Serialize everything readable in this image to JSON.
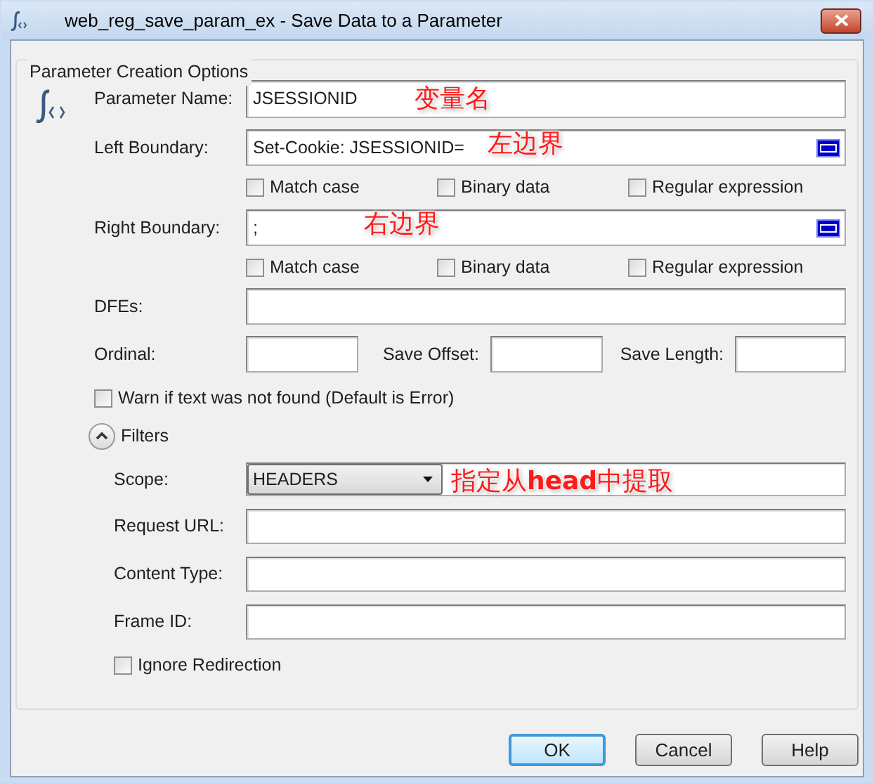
{
  "window": {
    "title": "web_reg_save_param_ex - Save Data to a Parameter"
  },
  "group": {
    "title": "Parameter Creation Options"
  },
  "parameter_name": {
    "label": "Parameter Name:",
    "value": "JSESSIONID",
    "annotation": "变量名"
  },
  "left_boundary": {
    "label": "Left Boundary:",
    "value": "Set-Cookie: JSESSIONID=",
    "annotation": "左边界",
    "options": [
      {
        "label": "Match case",
        "checked": false
      },
      {
        "label": "Binary data",
        "checked": false
      },
      {
        "label": "Regular expression",
        "checked": false
      }
    ]
  },
  "right_boundary": {
    "label": "Right Boundary:",
    "value": ";",
    "annotation": "右边界",
    "options": [
      {
        "label": "Match case",
        "checked": false
      },
      {
        "label": "Binary data",
        "checked": false
      },
      {
        "label": "Regular expression",
        "checked": false
      }
    ]
  },
  "dfes": {
    "label": "DFEs:"
  },
  "numbers": [
    {
      "label": "Ordinal:"
    },
    {
      "label": "Save Offset:"
    },
    {
      "label": "Save Length:"
    }
  ],
  "warn": {
    "label": "Warn if text was not found (Default is Error)",
    "checked": false
  },
  "filters": {
    "label": "Filters",
    "expanded": true,
    "scope": {
      "label": "Scope:",
      "value": "HEADERS",
      "annotation": "指定从**head**中提取"
    },
    "fields": [
      {
        "label": "Request URL:"
      },
      {
        "label": "Content Type:"
      },
      {
        "label": "Frame ID:"
      }
    ],
    "ignore_redirection": {
      "label": "Ignore Redirection",
      "checked": false
    }
  },
  "buttons": [
    {
      "label": "OK",
      "default": true
    },
    {
      "label": "Cancel",
      "default": false
    },
    {
      "label": "Help",
      "default": false
    }
  ]
}
